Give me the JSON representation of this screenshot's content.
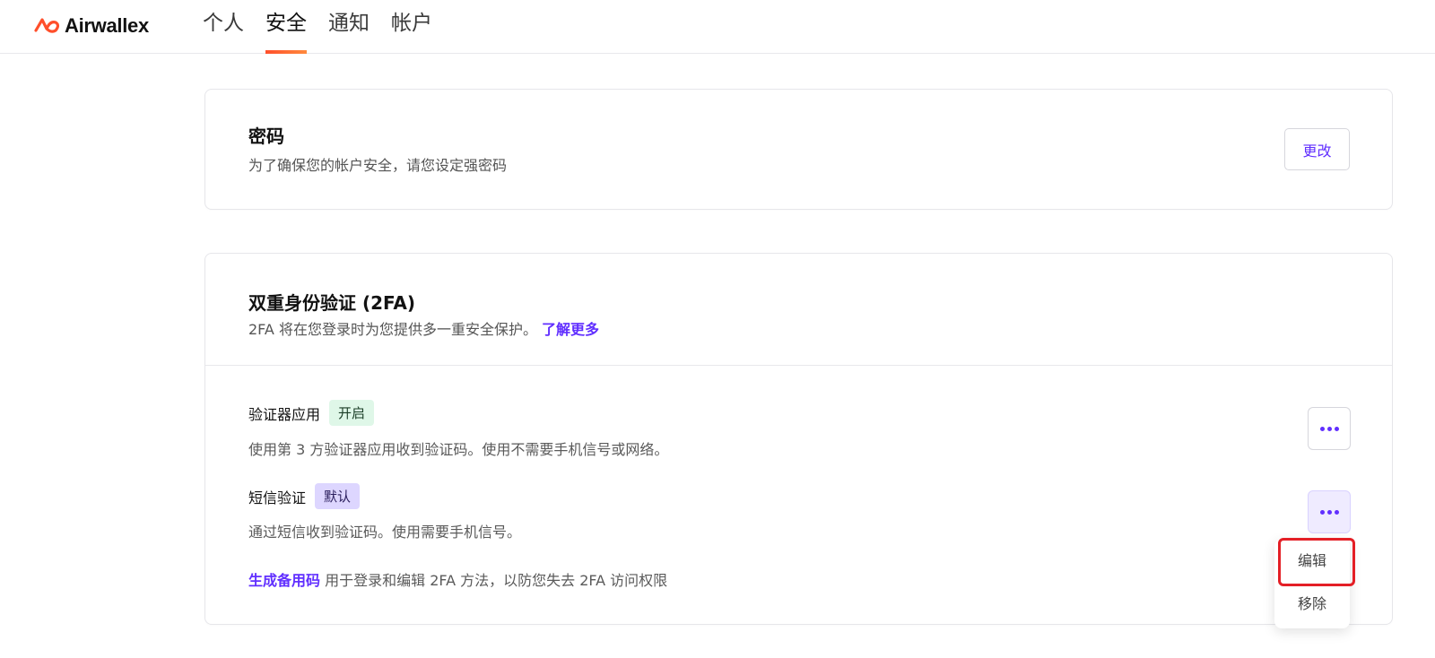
{
  "app": {
    "brand": "Airwallex",
    "accent_color": "#612fff",
    "brand_color": "#ff4f2b"
  },
  "nav": {
    "tabs": [
      {
        "label": "个人",
        "active": false
      },
      {
        "label": "安全",
        "active": true
      },
      {
        "label": "通知",
        "active": false
      },
      {
        "label": "帐户",
        "active": false
      }
    ]
  },
  "password_card": {
    "title": "密码",
    "subtitle": "为了确保您的帐户安全，请您设定强密码",
    "change_label": "更改"
  },
  "twofa_card": {
    "title": "双重身份验证 (2FA)",
    "subtitle": "2FA 将在您登录时为您提供多一重安全保护。",
    "learn_more": "了解更多",
    "methods": [
      {
        "name": "验证器应用",
        "badge": "开启",
        "description": "使用第 3 方验证器应用收到验证码。使用不需要手机信号或网络。",
        "more_icon": "more-dots-icon"
      },
      {
        "name": "短信验证",
        "badge": "默认",
        "description": "通过短信收到验证码。使用需要手机信号。",
        "more_icon": "more-dots-icon"
      }
    ],
    "backup": {
      "link": "生成备用码",
      "text": "用于登录和编辑 2FA 方法，以防您失去 2FA 访问权限"
    }
  },
  "dropdown": {
    "items": [
      {
        "label": "编辑",
        "highlighted": true
      },
      {
        "label": "移除",
        "highlighted": false
      }
    ]
  }
}
